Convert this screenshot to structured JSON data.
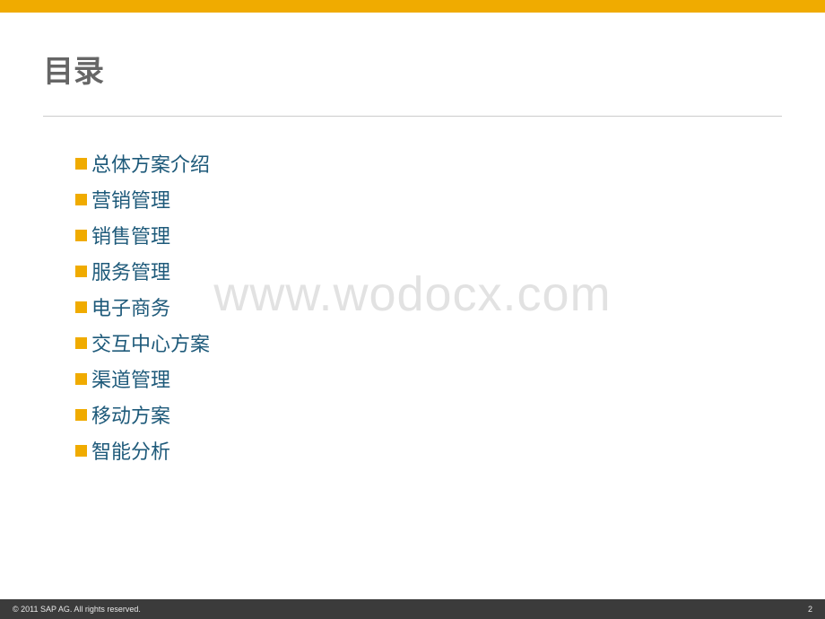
{
  "title": "目录",
  "items": [
    "总体方案介绍",
    "营销管理",
    "销售管理",
    "服务管理",
    "电子商务",
    "交互中心方案",
    "渠道管理",
    "移动方案",
    "智能分析"
  ],
  "watermark": "www.wodocx.com",
  "footer": {
    "copyright": "©  2011 SAP AG. All rights reserved.",
    "page": "2"
  }
}
